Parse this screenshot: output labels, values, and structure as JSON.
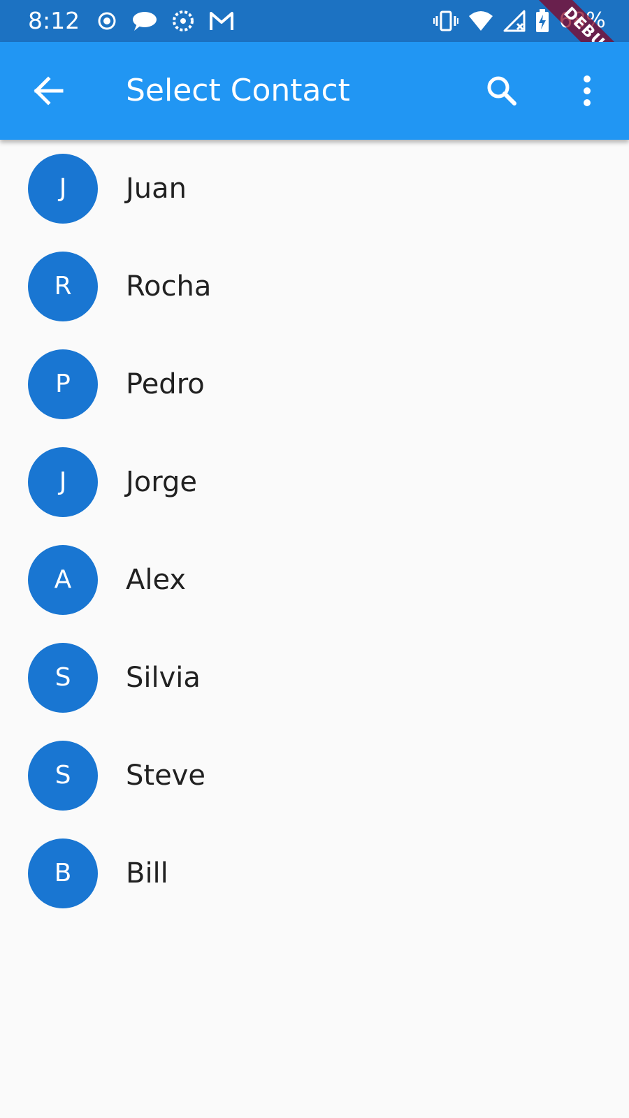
{
  "status_bar": {
    "time": "8:12",
    "battery_percent": "68%",
    "left_icons": [
      "record-icon",
      "chat-icon",
      "sync-icon",
      "gmail-icon"
    ],
    "right_icons": [
      "vibrate-icon",
      "wifi-icon",
      "no-signal-icon",
      "battery-charging-icon"
    ]
  },
  "debug_banner": {
    "label": "DEBUG"
  },
  "app_bar": {
    "title": "Select Contact",
    "back_icon": "arrow-back-icon",
    "search_icon": "search-icon",
    "more_icon": "more-vert-icon",
    "color": "#2196f3"
  },
  "contacts": [
    {
      "initial": "J",
      "name": "Juan"
    },
    {
      "initial": "R",
      "name": "Rocha"
    },
    {
      "initial": "P",
      "name": "Pedro"
    },
    {
      "initial": "J",
      "name": "Jorge"
    },
    {
      "initial": "A",
      "name": "Alex"
    },
    {
      "initial": "S",
      "name": "Silvia"
    },
    {
      "initial": "S",
      "name": "Steve"
    },
    {
      "initial": "B",
      "name": "Bill"
    }
  ],
  "colors": {
    "status_bar": "#1c72c2",
    "avatar": "#1976d2",
    "background": "#fafafa",
    "text": "#212121"
  }
}
